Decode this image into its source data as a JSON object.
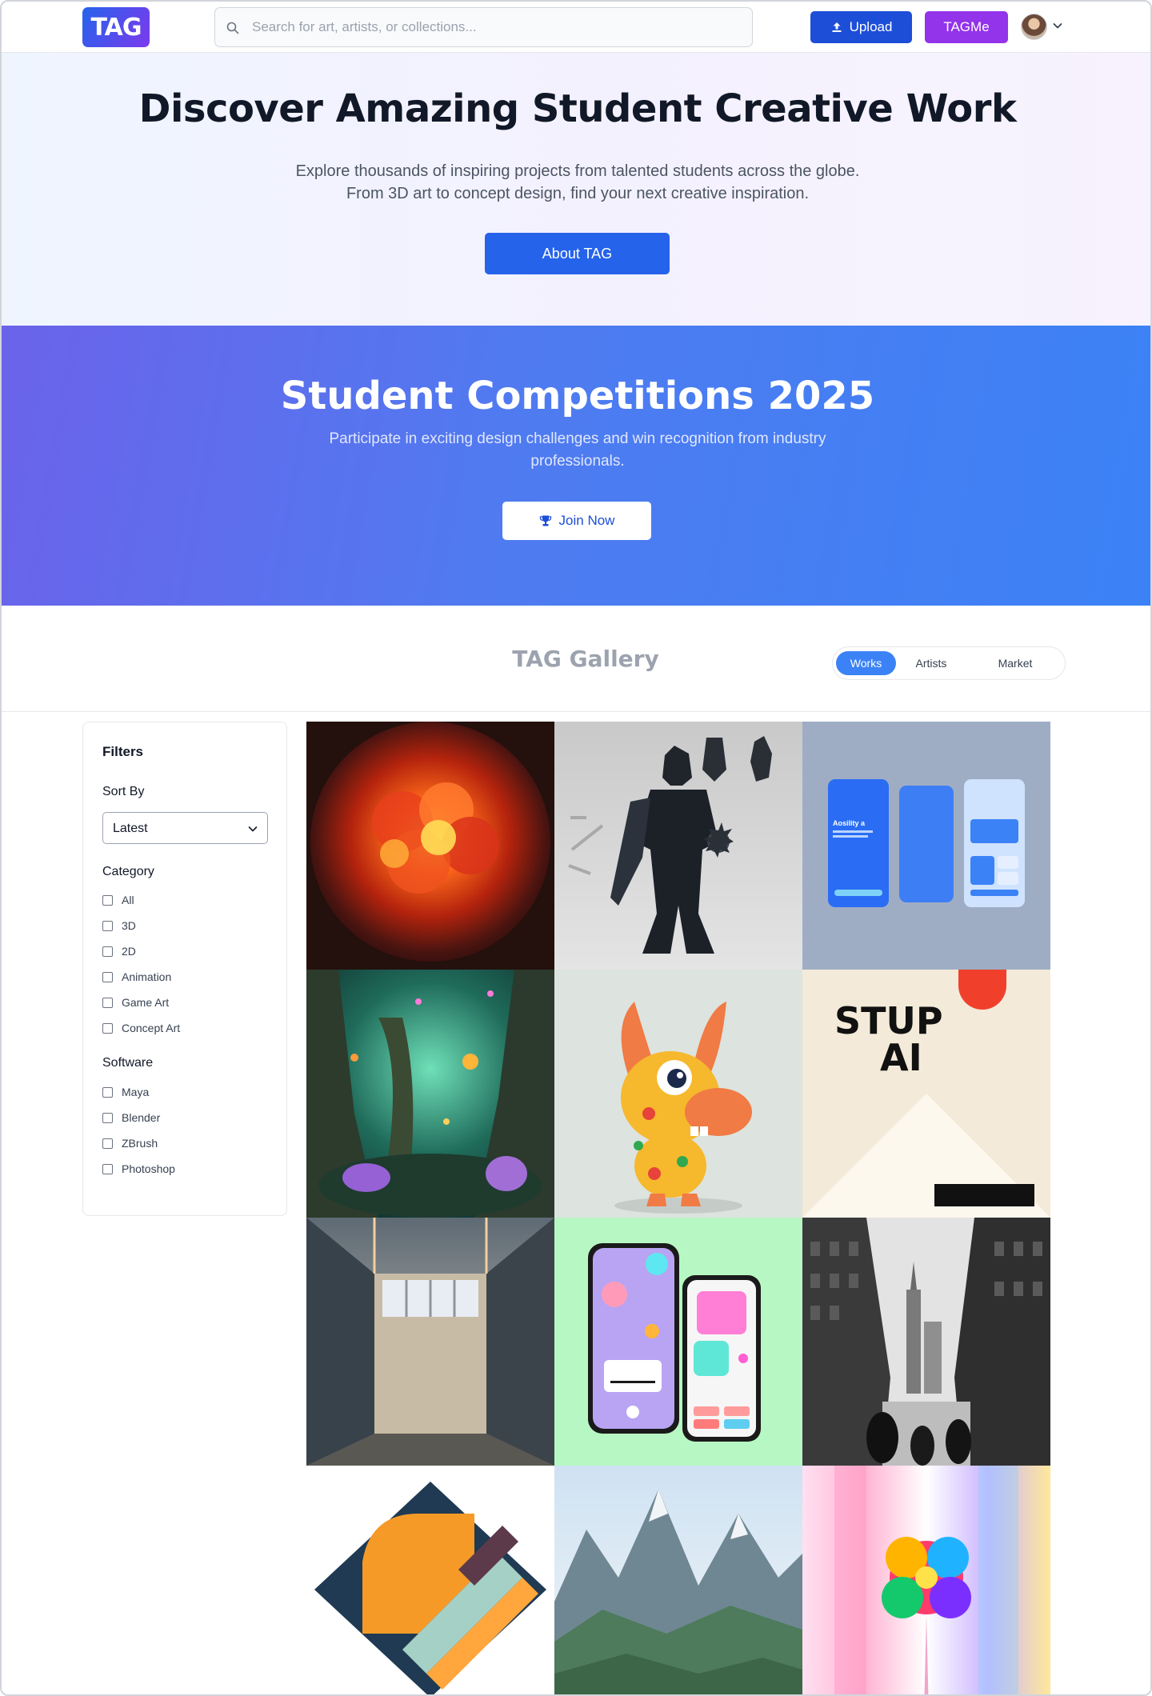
{
  "header": {
    "logo_text": "TAG",
    "search_placeholder": "Search for art, artists, or collections...",
    "upload_label": "Upload",
    "tagme_label": "TAGMe"
  },
  "hero": {
    "title": "Discover Amazing Student Creative Work",
    "subtitle_line1": "Explore thousands of inspiring projects from talented students across the globe.",
    "subtitle_line2": "From 3D art to concept design, find your next creative inspiration.",
    "cta_label": "About TAG"
  },
  "competition": {
    "title": "Student Competitions 2025",
    "subtitle": "Participate in exciting design challenges and win recognition from industry professionals.",
    "cta_label": "Join Now"
  },
  "gallery": {
    "title": "TAG Gallery",
    "tabs": [
      {
        "label": "Works",
        "active": true
      },
      {
        "label": "Artists",
        "active": false
      },
      {
        "label": "Market",
        "active": false
      }
    ],
    "tiles": [
      {
        "subject": "fiery explosion"
      },
      {
        "subject": "dark armored knight"
      },
      {
        "subject": "mobile app UI screens",
        "text": "Aosility a"
      },
      {
        "subject": "glowing fantasy forest"
      },
      {
        "subject": "cartoon dinosaur character"
      },
      {
        "subject": "typographic poster",
        "text_line1": "STUP",
        "text_line2": "AI"
      },
      {
        "subject": "empty lit room"
      },
      {
        "subject": "phone app mockups"
      },
      {
        "subject": "black and white city street"
      },
      {
        "subject": "abstract geometric shapes"
      },
      {
        "subject": "mountain landscape"
      },
      {
        "subject": "colorful abstract flower"
      }
    ]
  },
  "filters": {
    "title": "Filters",
    "sort_label": "Sort By",
    "sort_value": "Latest",
    "category_label": "Category",
    "categories": [
      "All",
      "3D",
      "2D",
      "Animation",
      "Game Art",
      "Concept Art"
    ],
    "software_label": "Software",
    "software": [
      "Maya",
      "Blender",
      "ZBrush",
      "Photoshop"
    ]
  },
  "colors": {
    "primary": "#2563eb",
    "upload": "#1d4ed8",
    "tagme": "#9333ea",
    "tab_active": "#3b82f6"
  },
  "icons": {
    "search": "search-icon",
    "upload": "upload-icon",
    "trophy": "trophy-icon",
    "chevron": "chevron-down-icon"
  }
}
